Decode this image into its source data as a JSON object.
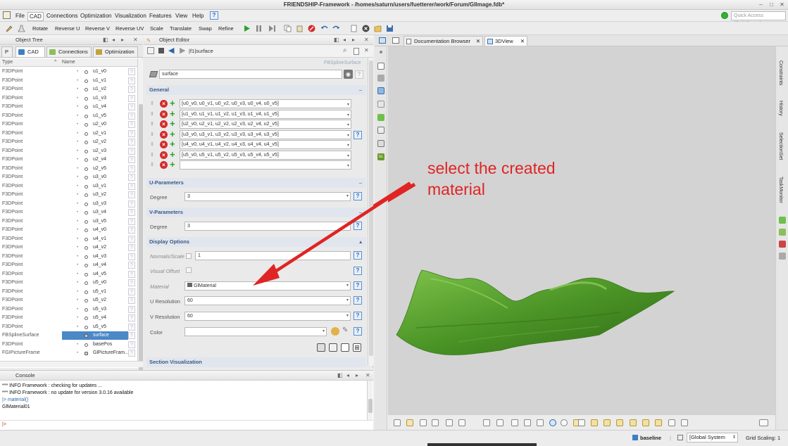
{
  "window": {
    "title": "FRIENDSHIP-Framework - /homes/saturn/users/fuetterer/work/Forum/GlImage.fdb*"
  },
  "menu": {
    "items": [
      "File",
      "CAD",
      "Connections",
      "Optimization",
      "Visualization",
      "Features",
      "View",
      "Help"
    ],
    "help_icon": "?",
    "quick_access_placeholder": "Quick Access (Ctrl+Space)"
  },
  "toolbar": {
    "actions": [
      "Rotate",
      "Reverse U",
      "Reverse V",
      "Reverse UV",
      "Scale",
      "Translate",
      "Swap",
      "Refine"
    ]
  },
  "object_tree": {
    "title": "Object Tree",
    "tabs": [
      "P",
      "CAD",
      "Connections",
      "Optimization"
    ],
    "columns": [
      "Type",
      "Name"
    ],
    "rows": [
      {
        "type": "F3DPoint",
        "name": "u1_v0"
      },
      {
        "type": "F3DPoint",
        "name": "u1_v1"
      },
      {
        "type": "F3DPoint",
        "name": "u1_v2"
      },
      {
        "type": "F3DPoint",
        "name": "u1_v3"
      },
      {
        "type": "F3DPoint",
        "name": "u1_v4"
      },
      {
        "type": "F3DPoint",
        "name": "u1_v5"
      },
      {
        "type": "F3DPoint",
        "name": "u2_v0"
      },
      {
        "type": "F3DPoint",
        "name": "u2_v1"
      },
      {
        "type": "F3DPoint",
        "name": "u2_v2"
      },
      {
        "type": "F3DPoint",
        "name": "u2_v3"
      },
      {
        "type": "F3DPoint",
        "name": "u2_v4"
      },
      {
        "type": "F3DPoint",
        "name": "u2_v5"
      },
      {
        "type": "F3DPoint",
        "name": "u3_v0"
      },
      {
        "type": "F3DPoint",
        "name": "u3_v1"
      },
      {
        "type": "F3DPoint",
        "name": "u3_v2"
      },
      {
        "type": "F3DPoint",
        "name": "u3_v3"
      },
      {
        "type": "F3DPoint",
        "name": "u3_v4"
      },
      {
        "type": "F3DPoint",
        "name": "u3_v5"
      },
      {
        "type": "F3DPoint",
        "name": "u4_v0"
      },
      {
        "type": "F3DPoint",
        "name": "u4_v1"
      },
      {
        "type": "F3DPoint",
        "name": "u4_v2"
      },
      {
        "type": "F3DPoint",
        "name": "u4_v3"
      },
      {
        "type": "F3DPoint",
        "name": "u4_v4"
      },
      {
        "type": "F3DPoint",
        "name": "u4_v5"
      },
      {
        "type": "F3DPoint",
        "name": "u5_v0"
      },
      {
        "type": "F3DPoint",
        "name": "u5_v1"
      },
      {
        "type": "F3DPoint",
        "name": "u5_v2"
      },
      {
        "type": "F3DPoint",
        "name": "u5_v3"
      },
      {
        "type": "F3DPoint",
        "name": "u5_v4"
      },
      {
        "type": "F3DPoint",
        "name": "u5_v5"
      },
      {
        "type": "FBSplineSurface",
        "name": "surface",
        "selected": true
      },
      {
        "type": "F3DPoint",
        "name": "basePos"
      },
      {
        "type": "FGIPictureFrame",
        "name": "GlPictureFram..."
      }
    ]
  },
  "object_editor": {
    "title": "Object Editor",
    "path": "|f1|surface",
    "type_label": "FBSplineSurface",
    "name_value": "surface",
    "sections": {
      "general": "General",
      "u_params": "U-Parameters",
      "v_params": "V-Parameters",
      "display": "Display Options",
      "section_vis": "Section Visualization"
    },
    "control_rows": [
      "[u0_v0, u0_v1, u0_v2, u0_v3, u0_v4, u0_v5]",
      "[u1_v0, u1_v1, u1_v2, u1_v3, u1_v4, u1_v5]",
      "[u2_v0, u2_v1, u2_v2, u2_v3, u2_v4, u2_v5]",
      "[u3_v0, u3_v1, u3_v2, u3_v3, u3_v4, u3_v5]",
      "[u4_v0, u4_v1, u4_v2, u4_v3, u4_v4, u4_v5]",
      "[u5_v0, u5_v1, u5_v2, u5_v3, u5_v4, u5_v5]",
      ""
    ],
    "u_degree_label": "Degree",
    "u_degree": "3",
    "v_degree_label": "Degree",
    "v_degree": "3",
    "normals_label": "Normals/Scale",
    "normals_value": "1",
    "visual_offset_label": "Visual Offset",
    "material_label": "Material",
    "material_value": "GlMaterial",
    "u_res_label": "U Resolution",
    "u_res": "60",
    "v_res_label": "V Resolution",
    "v_res": "60",
    "color_label": "Color",
    "color_value": ""
  },
  "view": {
    "tabs": [
      "Documentation Browser",
      "3DView"
    ],
    "annotation_line1": "select the created",
    "annotation_line2": "material",
    "surface_colors": {
      "dark": "#2f6b16",
      "mid": "#4b9426",
      "light": "#7dc24a"
    }
  },
  "right_tabs": [
    "Constraints",
    "History",
    "SelectionSet",
    "TaskMonitor"
  ],
  "console": {
    "title": "Console",
    "lines": [
      "*** INFO Framework : checking for updates ...",
      "*** INFO Framework : no update for version 3.0.16 available",
      "|> material()",
      "GlMaterial01"
    ],
    "prompt": "|>"
  },
  "statusbar": {
    "baseline": "baseline",
    "coord_system": "[Global System",
    "grid_scaling": "Grid Scaling: 1"
  },
  "colors": {
    "accent": "#4a88c8",
    "annotation": "#e02424",
    "section_header_text": "#3c5a80"
  }
}
